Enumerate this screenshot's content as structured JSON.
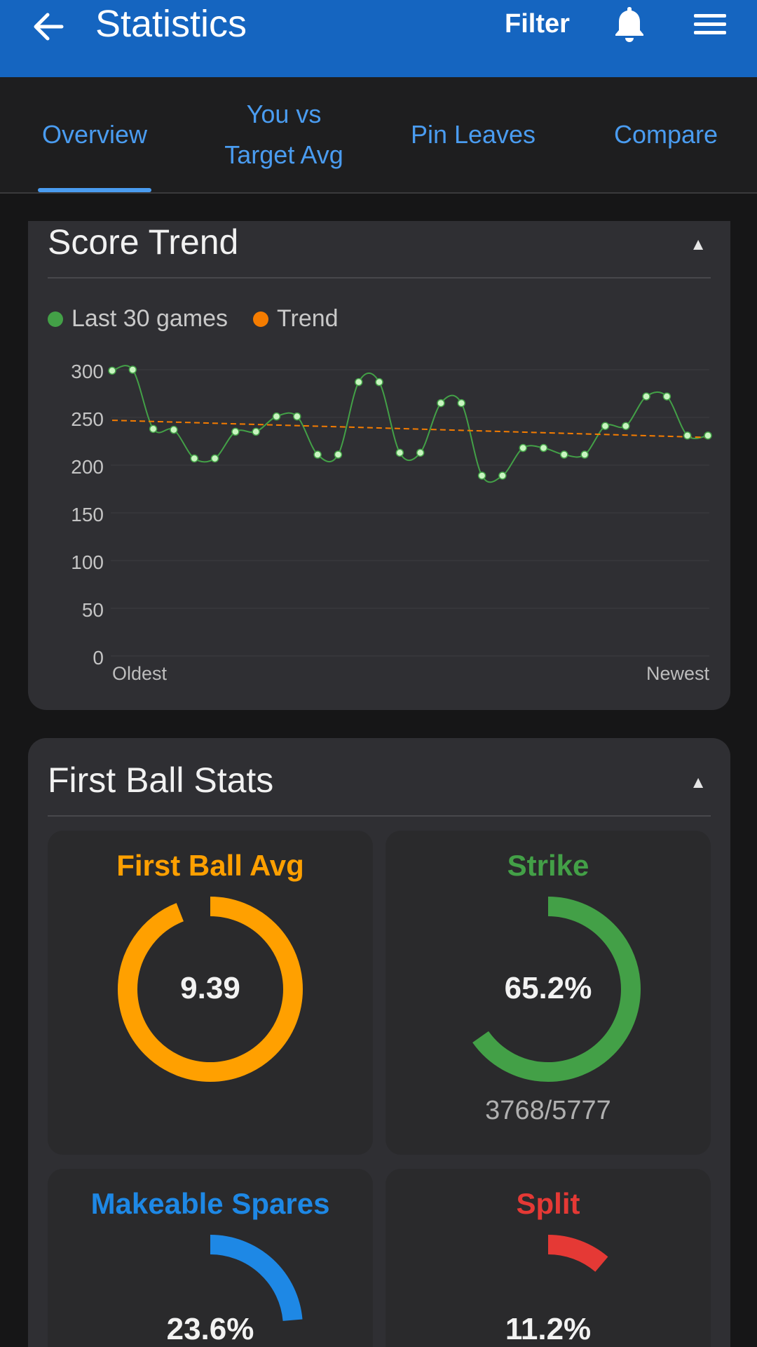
{
  "appbar": {
    "title": "Statistics",
    "filter_label": "Filter",
    "back_icon": "arrow-left-icon",
    "bell_icon": "bell-icon",
    "menu_icon": "hamburger-menu-icon",
    "color": "#1565c0"
  },
  "tabs": [
    {
      "label_lines": [
        "Overview"
      ],
      "active": true
    },
    {
      "label_lines": [
        "You vs",
        "Target Avg"
      ],
      "active": false
    },
    {
      "label_lines": [
        "Pin Leaves"
      ],
      "active": false
    },
    {
      "label_lines": [
        "Compare"
      ],
      "active": false
    }
  ],
  "score_trend": {
    "title": "Score Trend",
    "legend": [
      {
        "label": "Last 30 games",
        "color": "#43a047"
      },
      {
        "label": "Trend",
        "color": "#f57c00"
      }
    ]
  },
  "chart_data": {
    "type": "line",
    "ylim": [
      0,
      300
    ],
    "y_ticks": [
      300,
      250,
      200,
      150,
      100,
      50,
      0
    ],
    "x_start_label": "Oldest",
    "x_end_label": "Newest",
    "grid": true,
    "legend_position": "top-left",
    "series": [
      {
        "name": "Last 30 games",
        "color": "#43a047",
        "values": [
          299,
          300,
          238,
          237,
          207,
          207,
          235,
          235,
          251,
          251,
          211,
          211,
          287,
          287,
          213,
          213,
          265,
          265,
          189,
          189,
          218,
          218,
          211,
          211,
          241,
          241,
          272,
          272,
          231,
          231
        ]
      },
      {
        "name": "Trend",
        "color": "#f57c00",
        "start": 247,
        "end": 229
      }
    ]
  },
  "first_ball": {
    "title": "First Ball Stats",
    "tiles": [
      {
        "title": "First Ball Avg",
        "value": "9.39",
        "sub": "",
        "color": "#ffa000",
        "fraction": 0.94
      },
      {
        "title": "Strike",
        "value": "65.2%",
        "sub": "3768/5777",
        "color": "#43a047",
        "fraction": 0.652
      },
      {
        "title": "Makeable Spares",
        "value": "23.6%",
        "sub": "",
        "color": "#1e88e5",
        "fraction": 0.236
      },
      {
        "title": "Split",
        "value": "11.2%",
        "sub": "",
        "color": "#e53935",
        "fraction": 0.112
      }
    ]
  }
}
